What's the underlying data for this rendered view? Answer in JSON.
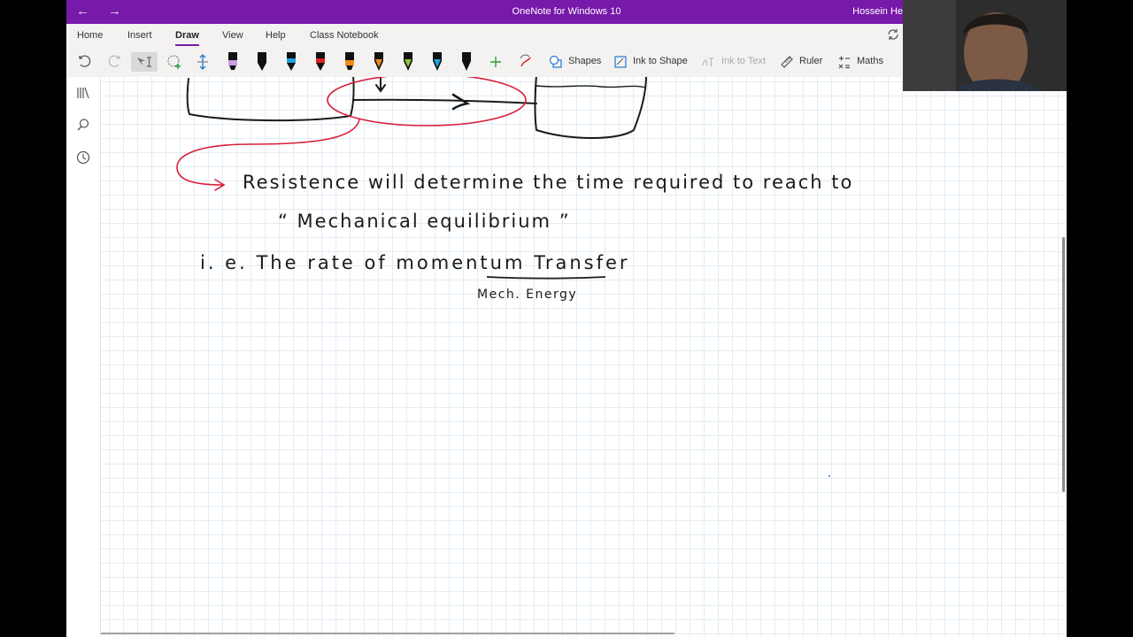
{
  "window": {
    "title": "OneNote for Windows 10",
    "user": "Hossein He"
  },
  "tabs": [
    "Home",
    "Insert",
    "Draw",
    "View",
    "Help",
    "Class Notebook"
  ],
  "active_tab": "Draw",
  "ribbon": {
    "shapes": "Shapes",
    "ink_to_shape": "Ink to Shape",
    "ink_to_text": "Ink to Text",
    "ruler": "Ruler",
    "maths": "Maths"
  },
  "pens": [
    {
      "color": "#c7a0e0",
      "type": "highlighter"
    },
    {
      "color": "#111111",
      "type": "pen"
    },
    {
      "color": "#1ea0e0",
      "type": "pen"
    },
    {
      "color": "#e02020",
      "type": "pen"
    },
    {
      "color": "#f08a1c",
      "type": "highlighter"
    },
    {
      "color": "#f08a1c",
      "type": "pencil"
    },
    {
      "color": "#8cc63f",
      "type": "pencil"
    },
    {
      "color": "#1ea0e0",
      "type": "pencil"
    },
    {
      "color": "#111111",
      "type": "pencil"
    }
  ],
  "colors": {
    "accent": "#7719aa",
    "ink": "#1a1a1a",
    "red_ink": "#d81e3a"
  },
  "note": {
    "line1": "Resistence will determine the time required to reach to",
    "line2": "“ Mechanical equilibrium ”",
    "line3": "i. e. The rate of momentum Transfer",
    "line4": "Mech. Energy"
  }
}
